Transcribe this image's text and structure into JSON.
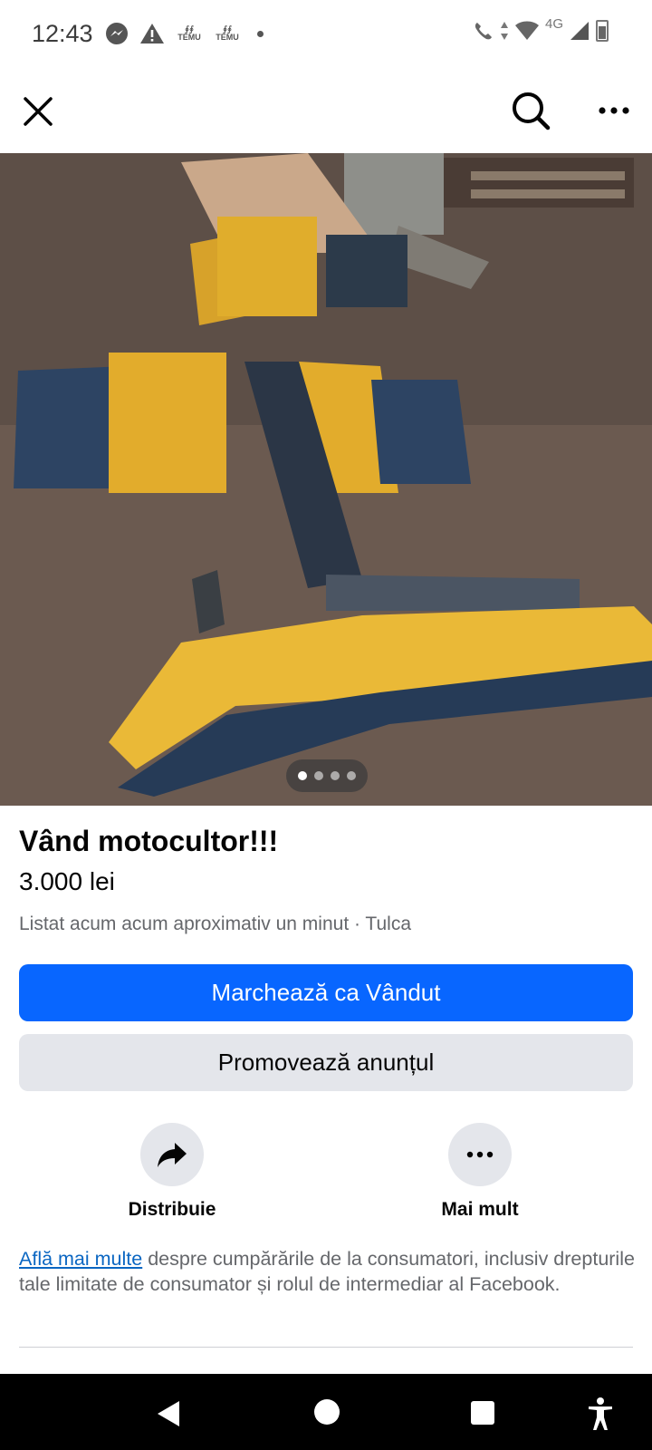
{
  "status_bar": {
    "time": "12:43",
    "left_icons": [
      "messenger-icon",
      "alert-icon",
      "temu-icon",
      "temu-icon",
      "dot-icon"
    ],
    "temu_label": "TEMU",
    "network": "4G",
    "right_icons": [
      "wifi-call-icon",
      "data-arrows-icon",
      "wifi-icon",
      "cell-signal-icon",
      "battery-icon"
    ]
  },
  "top_nav": {
    "icons": [
      "close-icon",
      "search-icon",
      "more-icon"
    ]
  },
  "photo": {
    "page_count": 4,
    "active_index": 0
  },
  "listing": {
    "title": "Vând motocultor!!!",
    "price": "3.000 lei",
    "meta": "Listat acum acum aproximativ un minut · Tulca"
  },
  "buttons": {
    "mark_sold": "Marchează ca Vândut",
    "promote": "Promovează anunțul"
  },
  "actions": [
    {
      "label": "Distribuie",
      "icon": "share-arrow-icon"
    },
    {
      "label": "Mai mult",
      "icon": "more-dots-icon"
    }
  ],
  "consumer_info": {
    "link": "Află mai multe",
    "text": " despre cumpărările de la consumatori, inclusiv drepturile tale limitate de consumator și rolul de intermediar al Facebook."
  },
  "colors": {
    "primary": "#0866ff",
    "secondary_bg": "#e4e6eb",
    "muted_text": "#65676b",
    "link": "#0a66c2"
  }
}
